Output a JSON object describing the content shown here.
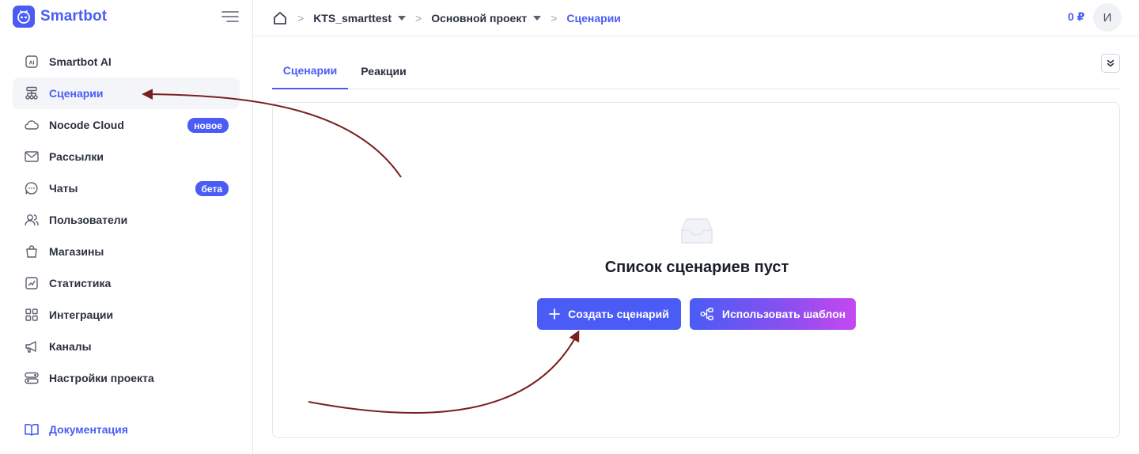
{
  "brand": {
    "name": "Smartbot"
  },
  "sidebar": {
    "items": [
      {
        "label": "Smartbot AI",
        "icon": "ai-icon"
      },
      {
        "label": "Сценарии",
        "icon": "flow-icon",
        "active": true
      },
      {
        "label": "Nocode Cloud",
        "icon": "cloud-icon",
        "badge": "новое"
      },
      {
        "label": "Рассылки",
        "icon": "mail-icon"
      },
      {
        "label": "Чаты",
        "icon": "chat-icon",
        "badge": "бета"
      },
      {
        "label": "Пользователи",
        "icon": "users-icon"
      },
      {
        "label": "Магазины",
        "icon": "bag-icon"
      },
      {
        "label": "Статистика",
        "icon": "chart-icon"
      },
      {
        "label": "Интеграции",
        "icon": "grid-icon"
      },
      {
        "label": "Каналы",
        "icon": "megaphone-icon"
      },
      {
        "label": "Настройки проекта",
        "icon": "toggles-icon"
      }
    ],
    "docs": {
      "label": "Документация",
      "icon": "book-icon"
    }
  },
  "topbar": {
    "breadcrumbs": [
      "KTS_smarttest",
      "Основной проект",
      "Сценарии"
    ],
    "balance": "0 ₽",
    "avatar_initial": "И"
  },
  "main": {
    "tabs": [
      {
        "label": "Сценарии",
        "active": true
      },
      {
        "label": "Реакции",
        "active": false
      }
    ],
    "empty_title": "Список сценариев пуст",
    "create_button": "Создать сценарий",
    "template_button": "Использовать шаблон"
  },
  "colors": {
    "accent": "#4a5cf5",
    "gradient_end": "#c548f0",
    "annotation_arrow": "#7a1f1f"
  }
}
